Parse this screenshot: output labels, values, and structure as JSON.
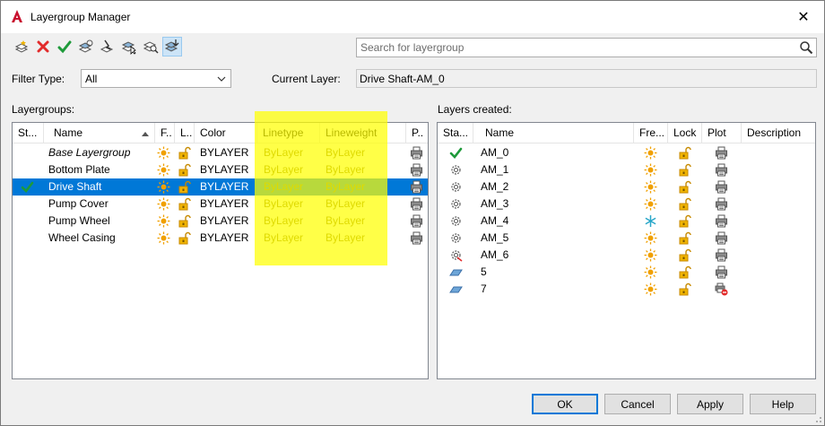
{
  "window": {
    "title": "Layergroup Manager",
    "close_glyph": "✕"
  },
  "toolbar": {
    "buttons": [
      "new-layergroup-icon",
      "delete-icon",
      "set-current-icon",
      "layer-states-icon",
      "filter-icon",
      "select-icon",
      "zoom-icon",
      "settings-icon"
    ]
  },
  "search": {
    "placeholder": "Search for layergroup",
    "value": ""
  },
  "filter": {
    "label": "Filter Type:",
    "value": "All"
  },
  "current_layer": {
    "label": "Current Layer:",
    "value": "Drive Shaft-AM_0"
  },
  "layergroups": {
    "label": "Layergroups:",
    "columns": [
      "St...",
      "Name",
      "F..",
      "L..",
      "Color",
      "Linetype",
      "Lineweight",
      "P.."
    ],
    "rows": [
      {
        "name": "Base Layergroup",
        "color": "BYLAYER",
        "linetype": "ByLayer",
        "lineweight": "ByLayer",
        "italic": true,
        "selected": false,
        "current": false
      },
      {
        "name": "Bottom Plate",
        "color": "BYLAYER",
        "linetype": "ByLayer",
        "lineweight": "ByLayer",
        "italic": false,
        "selected": false,
        "current": false
      },
      {
        "name": "Drive Shaft",
        "color": "BYLAYER",
        "linetype": "ByLayer",
        "lineweight": "ByLayer",
        "italic": false,
        "selected": true,
        "current": true
      },
      {
        "name": "Pump Cover",
        "color": "BYLAYER",
        "linetype": "ByLayer",
        "lineweight": "ByLayer",
        "italic": false,
        "selected": false,
        "current": false
      },
      {
        "name": "Pump Wheel",
        "color": "BYLAYER",
        "linetype": "ByLayer",
        "lineweight": "ByLayer",
        "italic": false,
        "selected": false,
        "current": false
      },
      {
        "name": "Wheel Casing",
        "color": "BYLAYER",
        "linetype": "ByLayer",
        "lineweight": "ByLayer",
        "italic": false,
        "selected": false,
        "current": false
      }
    ]
  },
  "layers_created": {
    "label": "Layers created:",
    "columns": [
      "Sta...",
      "Name",
      "Fre...",
      "Lock",
      "Plot",
      "Description"
    ],
    "rows": [
      {
        "name": "AM_0",
        "status": "current",
        "freeze": "sun",
        "plot": "printer"
      },
      {
        "name": "AM_1",
        "status": "gear",
        "freeze": "sun",
        "plot": "printer"
      },
      {
        "name": "AM_2",
        "status": "gear",
        "freeze": "sun",
        "plot": "printer"
      },
      {
        "name": "AM_3",
        "status": "gear",
        "freeze": "sun",
        "plot": "printer"
      },
      {
        "name": "AM_4",
        "status": "gear",
        "freeze": "snowflake",
        "plot": "printer"
      },
      {
        "name": "AM_5",
        "status": "gear",
        "freeze": "sun",
        "plot": "printer"
      },
      {
        "name": "AM_6",
        "status": "gear-red",
        "freeze": "sun",
        "plot": "printer"
      },
      {
        "name": "5",
        "status": "layer",
        "freeze": "sun",
        "plot": "printer"
      },
      {
        "name": "7",
        "status": "layer",
        "freeze": "sun",
        "plot": "no-plot"
      }
    ]
  },
  "buttons": {
    "ok": "OK",
    "cancel": "Cancel",
    "apply": "Apply",
    "help": "Help"
  },
  "colors": {
    "selection": "#0078d7",
    "highlight": "#ffff00",
    "accent": "#0078d7",
    "sun": "#f0a000"
  }
}
